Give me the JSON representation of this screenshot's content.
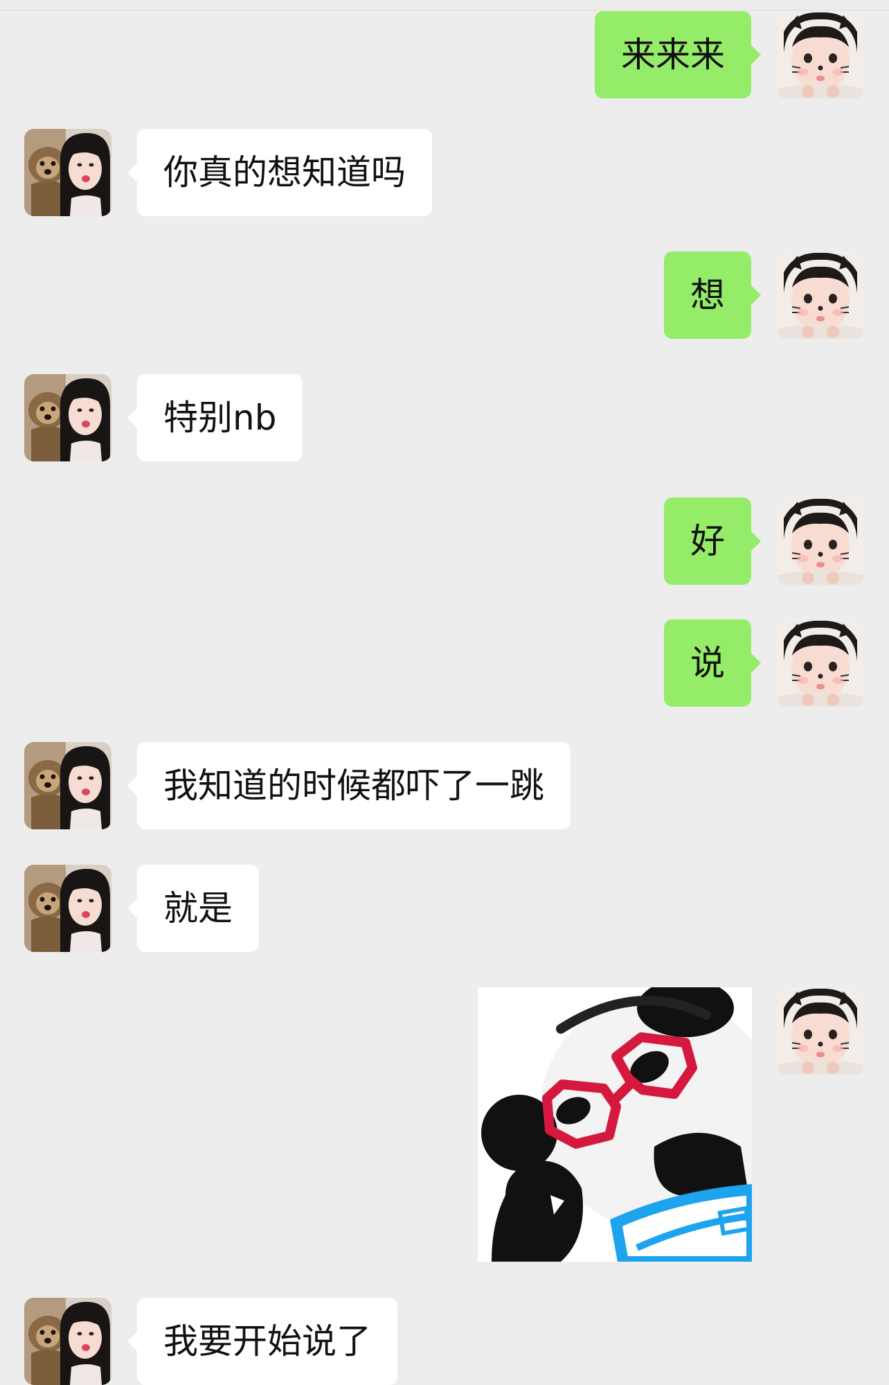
{
  "chat": {
    "messages": [
      {
        "from": "me",
        "text": "来来来"
      },
      {
        "from": "friend",
        "text": "你真的想知道吗"
      },
      {
        "from": "me",
        "text": "想"
      },
      {
        "from": "friend",
        "text": "特别nb"
      },
      {
        "from": "me",
        "text": "好"
      },
      {
        "from": "me",
        "text": "说"
      },
      {
        "from": "friend",
        "text": "我知道的时候都吓了一跳"
      },
      {
        "from": "friend",
        "text": "就是"
      },
      {
        "from": "me",
        "sticker": "panda-glasses-sticker"
      },
      {
        "from": "friend",
        "text": "我要开始说了"
      }
    ]
  },
  "colors": {
    "background": "#ededed",
    "my_bubble": "#95ec69",
    "friend_bubble": "#ffffff",
    "text": "#111111"
  }
}
